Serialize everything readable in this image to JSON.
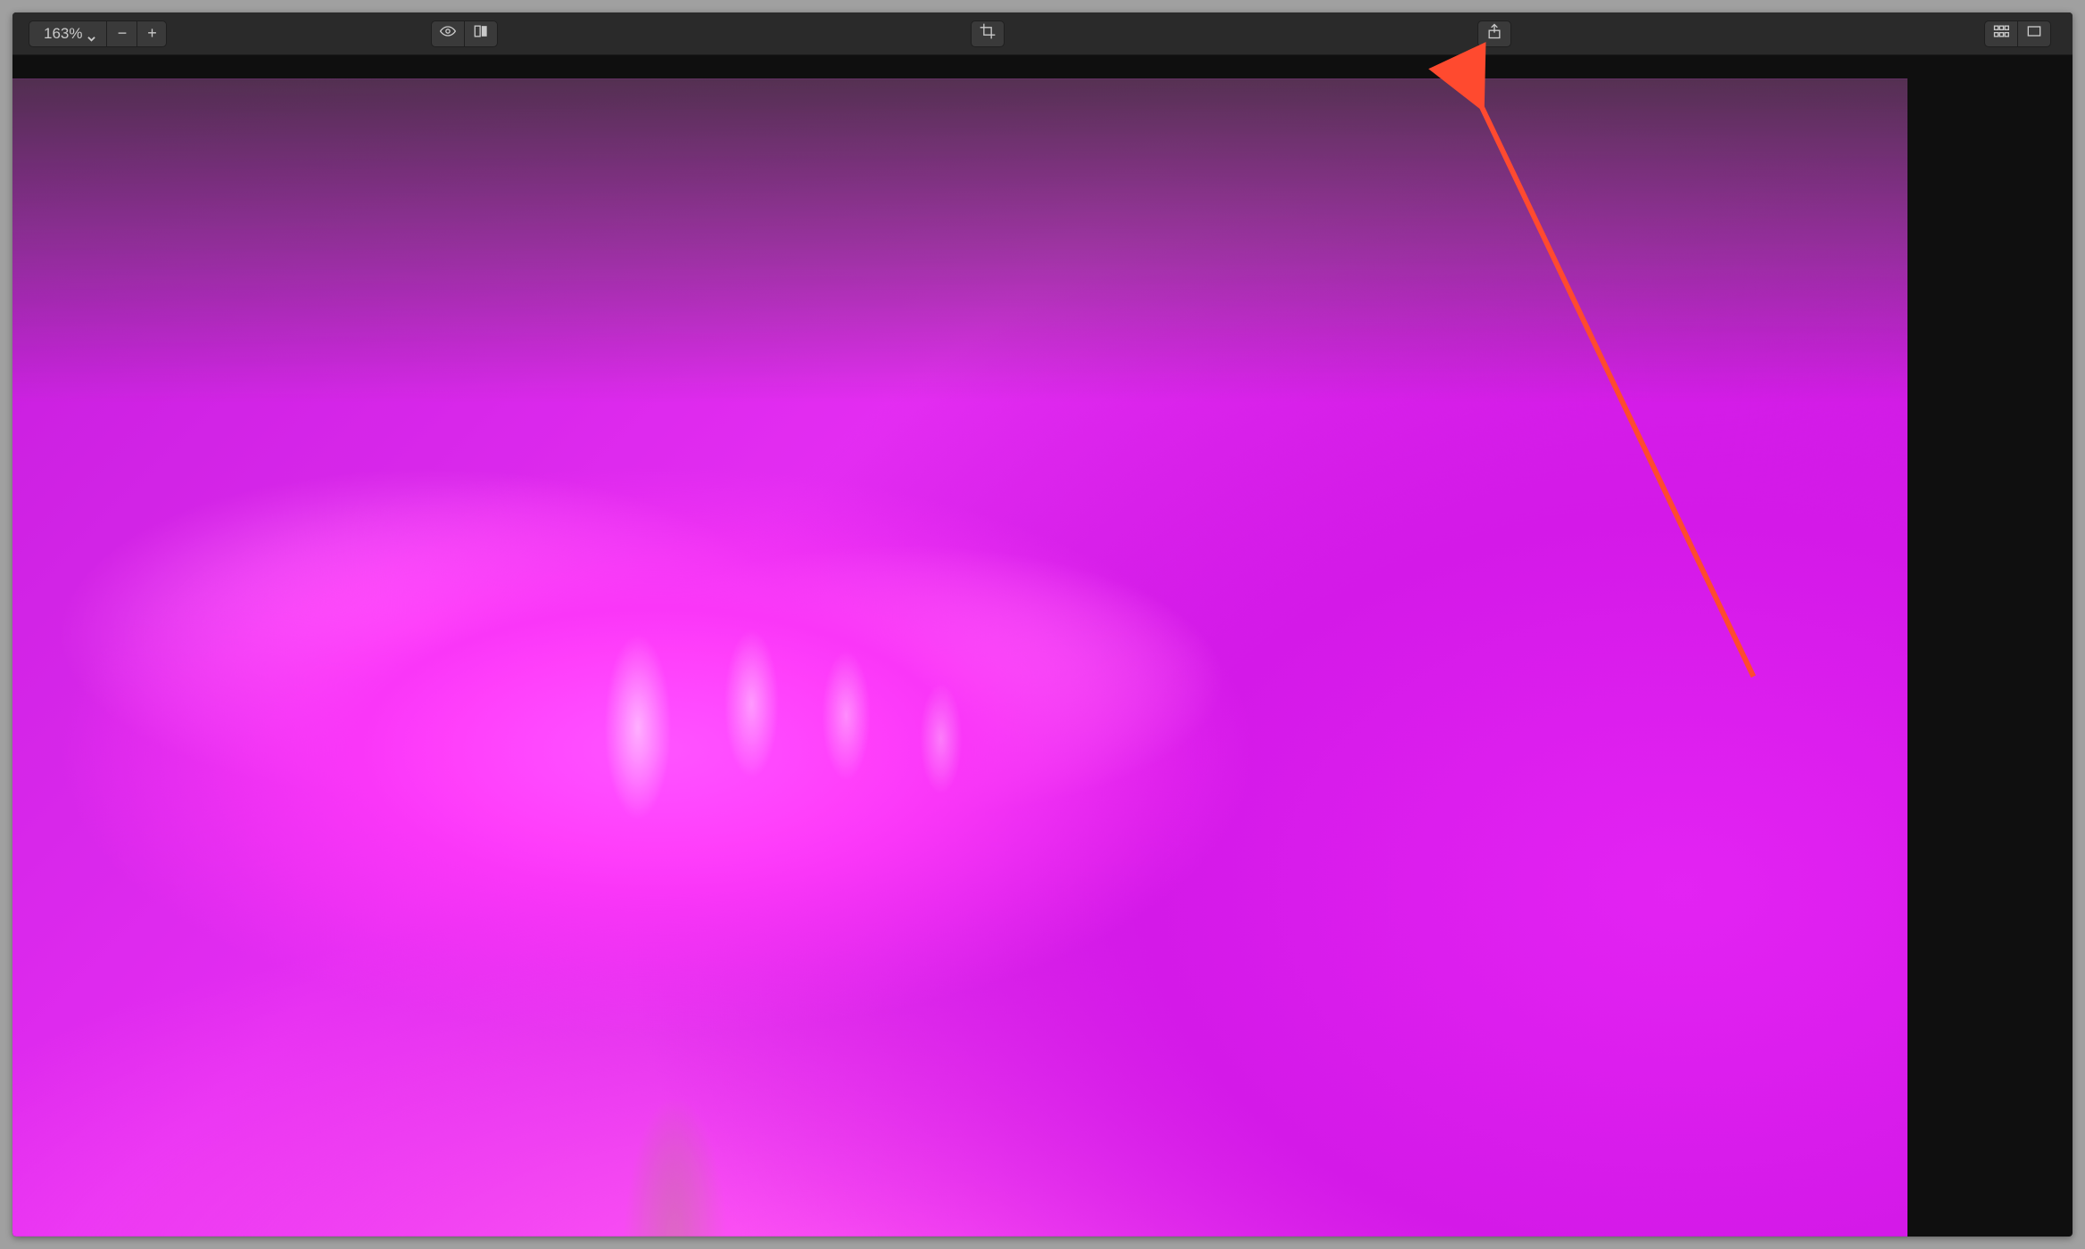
{
  "toolbar": {
    "zoom_value": "163%",
    "minus_label": "−",
    "plus_label": "+",
    "icons": {
      "chevron": "chevron-down-icon",
      "minus": "minus-icon",
      "plus": "plus-icon",
      "eye": "eye-icon",
      "compare": "compare-icon",
      "crop": "crop-icon",
      "share": "share-icon",
      "grid": "grid-icon",
      "single": "single-view-icon"
    }
  },
  "annotation": {
    "arrow_color": "#ff4a2f"
  }
}
